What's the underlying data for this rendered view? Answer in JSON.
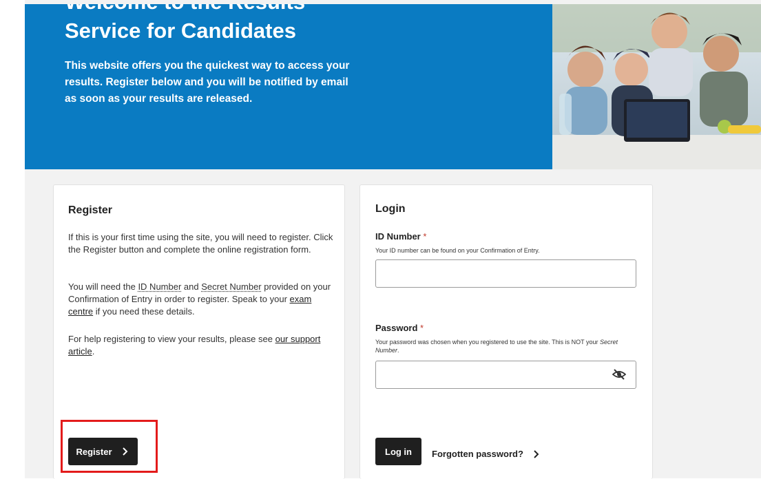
{
  "hero": {
    "title": "Service for Candidates",
    "text": "This website offers you the quickest way to access your results. Register below and you will be notified by email as soon as your results are released."
  },
  "register": {
    "heading": "Register",
    "para1": "If this is your first time using the site, you will need to register. Click the Register button and complete the online registration form.",
    "para2_a": "You will need the ",
    "para2_id": "ID Number",
    "para2_and": " and ",
    "para2_secret": "Secret Number",
    "para2_b": " provided on your Confirmation of Entry in order to register. Speak to your ",
    "para2_link": "exam centre",
    "para2_c": " if you need these details.",
    "para3_a": "For help registering to view your results, please see ",
    "para3_link": "our support article",
    "para3_b": ".",
    "button_label": "Register"
  },
  "login": {
    "heading": "Login",
    "id_label": "ID Number",
    "required_mark": "*",
    "id_hint": "Your ID number can be found on your Confirmation of Entry.",
    "id_value": "",
    "password_label": "Password",
    "password_hint_a": "Your password was chosen when you registered to use the site. This is NOT your ",
    "password_hint_b": "Secret Number",
    "password_hint_c": ".",
    "password_value": "",
    "login_button": "Log in",
    "forgot_link": "Forgotten password?"
  },
  "colors": {
    "hero_blue": "#0a7bc2",
    "button_dark": "#1f1f1f",
    "required_red": "#c0392b",
    "highlight_red": "#e31b1b"
  },
  "icons": [
    "chevron-right-icon",
    "eye-slash-icon"
  ]
}
